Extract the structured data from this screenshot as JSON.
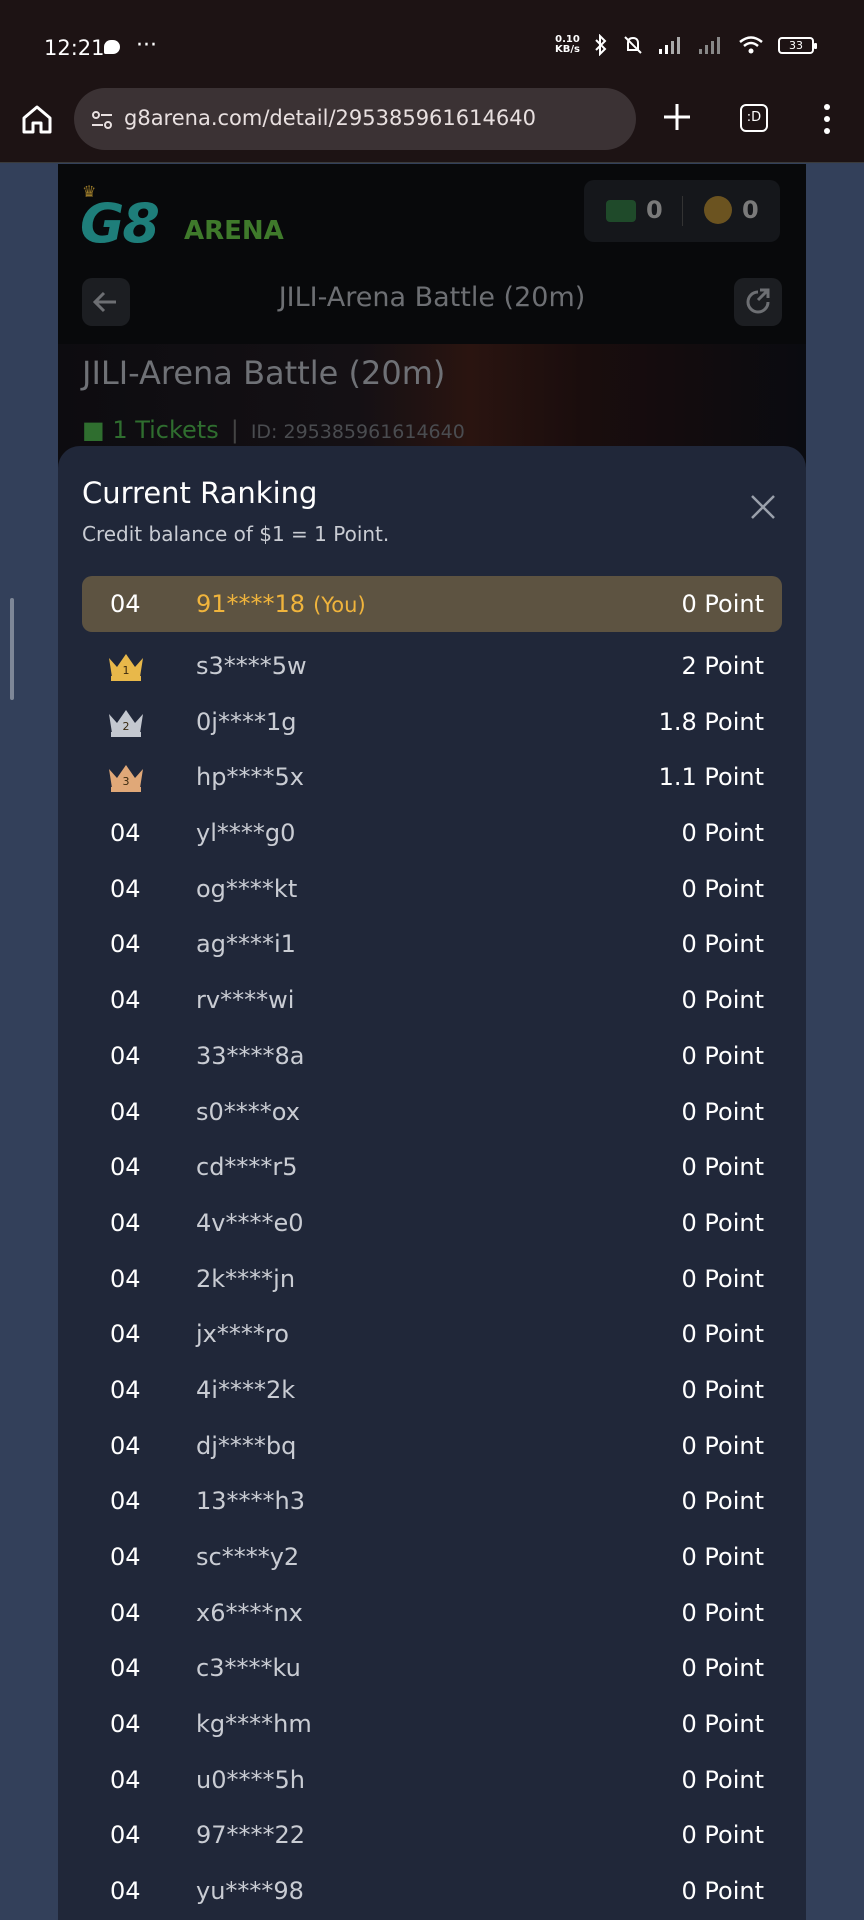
{
  "status_bar": {
    "time": "12:21",
    "more": "···",
    "speed_value": "0.10",
    "speed_unit": "KB/s",
    "battery": "33"
  },
  "browser": {
    "url": "g8arena.com/detail/295385961614640",
    "tabs_label": ":D"
  },
  "page": {
    "logo_main": "G8",
    "logo_sub": "ARENA",
    "tickets_count": "0",
    "coins_count": "0",
    "nav_title": "JILI-Arena Battle (20m)",
    "banner_title": "JILI-Arena Battle (20m)",
    "banner_tickets": "1 Tickets",
    "banner_id": "ID: 295385961614640"
  },
  "ranking": {
    "title": "Current Ranking",
    "subtitle": "Credit balance of $1 = 1 Point.",
    "you_row": {
      "rank": "04",
      "name": "91****18",
      "tag": "(You)",
      "points": "0 Point"
    },
    "rows": [
      {
        "rank": "1",
        "crown": "gold",
        "name": "s3****5w",
        "points": "2 Point"
      },
      {
        "rank": "2",
        "crown": "silver",
        "name": "0j****1g",
        "points": "1.8 Point"
      },
      {
        "rank": "3",
        "crown": "bronze",
        "name": "hp****5x",
        "points": "1.1 Point"
      },
      {
        "rank": "04",
        "name": "yl****g0",
        "points": "0 Point"
      },
      {
        "rank": "04",
        "name": "og****kt",
        "points": "0 Point"
      },
      {
        "rank": "04",
        "name": "ag****i1",
        "points": "0 Point"
      },
      {
        "rank": "04",
        "name": "rv****wi",
        "points": "0 Point"
      },
      {
        "rank": "04",
        "name": "33****8a",
        "points": "0 Point"
      },
      {
        "rank": "04",
        "name": "s0****ox",
        "points": "0 Point"
      },
      {
        "rank": "04",
        "name": "cd****r5",
        "points": "0 Point"
      },
      {
        "rank": "04",
        "name": "4v****e0",
        "points": "0 Point"
      },
      {
        "rank": "04",
        "name": "2k****jn",
        "points": "0 Point"
      },
      {
        "rank": "04",
        "name": "jx****ro",
        "points": "0 Point"
      },
      {
        "rank": "04",
        "name": "4i****2k",
        "points": "0 Point"
      },
      {
        "rank": "04",
        "name": "dj****bq",
        "points": "0 Point"
      },
      {
        "rank": "04",
        "name": "13****h3",
        "points": "0 Point"
      },
      {
        "rank": "04",
        "name": "sc****y2",
        "points": "0 Point"
      },
      {
        "rank": "04",
        "name": "x6****nx",
        "points": "0 Point"
      },
      {
        "rank": "04",
        "name": "c3****ku",
        "points": "0 Point"
      },
      {
        "rank": "04",
        "name": "kg****hm",
        "points": "0 Point"
      },
      {
        "rank": "04",
        "name": "u0****5h",
        "points": "0 Point"
      },
      {
        "rank": "04",
        "name": "97****22",
        "points": "0 Point"
      },
      {
        "rank": "04",
        "name": "yu****98",
        "points": "0 Point"
      }
    ]
  },
  "colors": {
    "sheet_bg": "#202739",
    "you_row_bg": "#5d5341",
    "you_accent": "#f0b43c",
    "crown_gold": "#e8b84a",
    "crown_silver": "#c4c8d0",
    "crown_bronze": "#e0a878"
  }
}
